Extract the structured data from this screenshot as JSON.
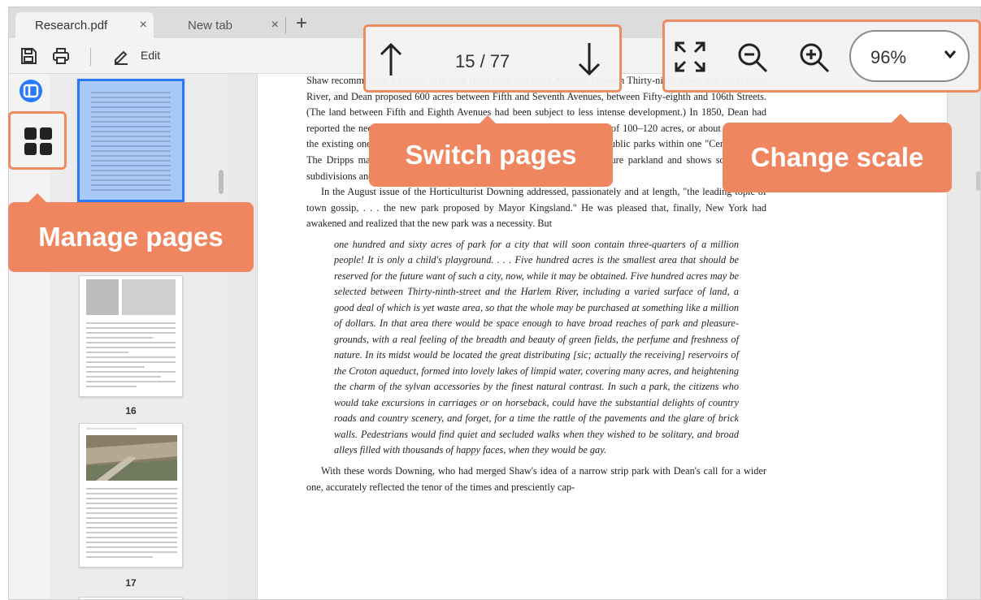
{
  "tabs": [
    {
      "label": "Research.pdf",
      "close": "×"
    },
    {
      "label": "New tab",
      "close": "×"
    }
  ],
  "new_tab": "+",
  "toolbar": {
    "edit_label": "Edit"
  },
  "thumbnails": [
    {
      "label": "16"
    },
    {
      "label": "17"
    }
  ],
  "page_nav": {
    "current": 15,
    "total": 77,
    "display": "15 / 77"
  },
  "zoom": {
    "value": "96%"
  },
  "callouts": {
    "manage": "Manage pages",
    "switch": "Switch pages",
    "scale": "Change scale"
  },
  "document": {
    "paragraph1": "Shaw recommended a narrow strip park from Fifth and Sixth Avenues between Thirty-ninth Street and the Harlem River, and Dean proposed 600 acres between Fifth and Seventh Avenues, between Fifty-eighth and 106th Streets. (The land between Fifth and Eighth Avenues had been subject to less intense development.) In 1850, Dean had reported the need for additional parks, recommending a single reservation of 100–120 acres, or about the size of the existing one. And he praised the idea of consolidating all these great public parks within one \"Central Park.\" The Dripps map (see fig. 7) identifies the major landowners of this future parkland and shows some of the subdivisions and buildings thereon.",
    "paragraph2": "In the August issue of the Horticulturist Downing addressed, passionately and at length, \"the leading topic of town gossip, . . . the new park proposed by Mayor Kingsland.\" He was pleased that, finally, New York had awakened and realized that the new park was a necessity. But",
    "quote": "one hundred and sixty acres of park for a city that will soon contain three-quarters of a million people! It is only a child's playground. . . . Five hundred acres is the smallest area that should be reserved for the future want of such a city, now, while it may be obtained. Five hundred acres may be selected between Thirty-ninth-street and the Harlem River, including a varied surface of land, a good deal of which is yet waste area, so that the whole may be purchased at something like a million of dollars. In that area there would be space enough to have broad reaches of park and pleasure-grounds, with a real feeling of the breadth and beauty of green fields, the perfume and freshness of nature. In its midst would be located the great distributing [sic; actually the receiving] reservoirs of the Croton aqueduct, formed into lovely lakes of limpid water, covering many acres, and heightening the charm of the sylvan accessories by the finest natural contrast. In such a park, the citizens who would take excursions in carriages or on horseback, could have the substantial delights of country roads and country scenery, and forget, for a time the rattle of the pavements and the glare of brick walls. Pedestrians would find quiet and secluded walks when they wished to be solitary, and broad alleys filled with thousands of happy faces, when they would be gay.",
    "paragraph3": "With these words Downing, who had merged Shaw's idea of a narrow strip park with Dean's call for a wider one, accurately reflected the tenor of the times and presciently cap-"
  },
  "colors": {
    "accent": "#ef8660",
    "selected_thumb": "#a8c8f8",
    "toggle_blue": "#2979ff"
  }
}
